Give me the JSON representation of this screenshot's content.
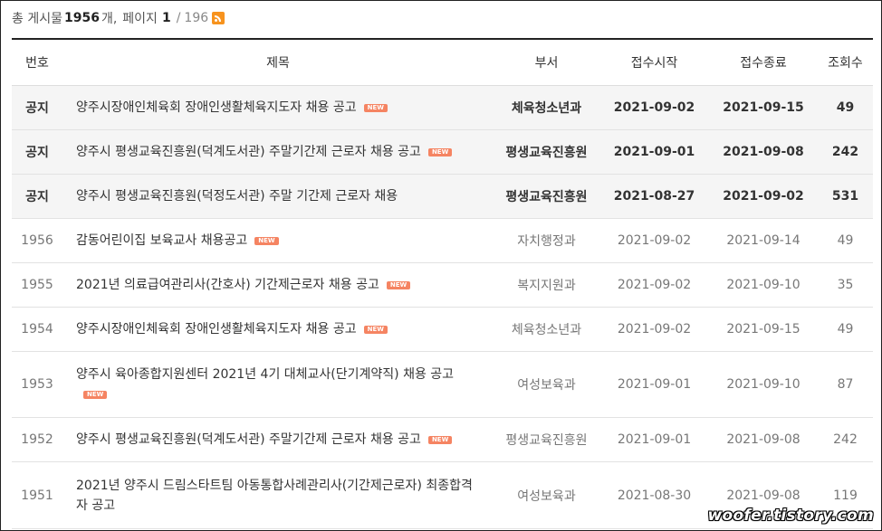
{
  "summary": {
    "prefix": "총 게시물",
    "total": "1956",
    "unit": "개,",
    "page_label": "페이지",
    "current_page": "1",
    "separator": "/",
    "total_pages": "196"
  },
  "columns": {
    "no": "번호",
    "title": "제목",
    "dept": "부서",
    "start": "접수시작",
    "end": "접수종료",
    "views": "조회수"
  },
  "new_label": "NEW",
  "rows": [
    {
      "no": "공지",
      "title": "양주시장애인체육회 장애인생활체육지도자 채용 공고",
      "new": true,
      "dept": "체육청소년과",
      "start": "2021-09-02",
      "end": "2021-09-15",
      "views": "49",
      "notice": true
    },
    {
      "no": "공지",
      "title": "양주시 평생교육진흥원(덕계도서관) 주말기간제 근로자 채용 공고",
      "new": true,
      "dept": "평생교육진흥원",
      "start": "2021-09-01",
      "end": "2021-09-08",
      "views": "242",
      "notice": true
    },
    {
      "no": "공지",
      "title": "양주시 평생교육진흥원(덕정도서관) 주말 기간제 근로자 채용",
      "new": false,
      "dept": "평생교육진흥원",
      "start": "2021-08-27",
      "end": "2021-09-02",
      "views": "531",
      "notice": true
    },
    {
      "no": "1956",
      "title": "감동어린이집 보육교사 채용공고",
      "new": true,
      "dept": "자치행정과",
      "start": "2021-09-02",
      "end": "2021-09-14",
      "views": "49",
      "notice": false
    },
    {
      "no": "1955",
      "title": "2021년 의료급여관리사(간호사) 기간제근로자 채용 공고",
      "new": true,
      "dept": "복지지원과",
      "start": "2021-09-02",
      "end": "2021-09-10",
      "views": "35",
      "notice": false
    },
    {
      "no": "1954",
      "title": "양주시장애인체육회 장애인생활체육지도자 채용 공고",
      "new": true,
      "dept": "체육청소년과",
      "start": "2021-09-02",
      "end": "2021-09-15",
      "views": "49",
      "notice": false
    },
    {
      "no": "1953",
      "title": "양주시 육아종합지원센터 2021년 4기 대체교사(단기계약직) 채용 공고",
      "new": true,
      "dept": "여성보육과",
      "start": "2021-09-01",
      "end": "2021-09-10",
      "views": "87",
      "notice": false
    },
    {
      "no": "1952",
      "title": "양주시 평생교육진흥원(덕계도서관) 주말기간제 근로자 채용 공고",
      "new": true,
      "dept": "평생교육진흥원",
      "start": "2021-09-01",
      "end": "2021-09-08",
      "views": "242",
      "notice": false
    },
    {
      "no": "1951",
      "title": "2021년 양주시 드림스타트팀 아동통합사례관리사(기간제근로자) 최종합격자 공고",
      "new": false,
      "dept": "여성보육과",
      "start": "2021-08-30",
      "end": "2021-09-08",
      "views": "119",
      "notice": false
    }
  ],
  "watermark": "woofer.tistory.com"
}
